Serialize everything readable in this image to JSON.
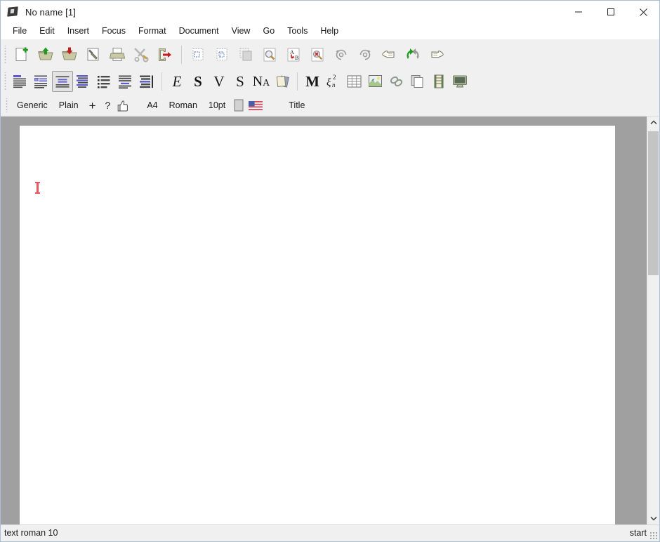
{
  "window": {
    "title": "No name [1]",
    "icon": "texmacs-logo-icon",
    "controls": [
      {
        "name": "minimize-button",
        "label": "–"
      },
      {
        "name": "maximize-button",
        "label": "□"
      },
      {
        "name": "close-button",
        "label": "✕"
      }
    ]
  },
  "menubar": {
    "items": [
      {
        "label": "File"
      },
      {
        "label": "Edit"
      },
      {
        "label": "Insert"
      },
      {
        "label": "Focus"
      },
      {
        "label": "Format"
      },
      {
        "label": "Document"
      },
      {
        "label": "View"
      },
      {
        "label": "Go"
      },
      {
        "label": "Tools"
      },
      {
        "label": "Help"
      }
    ]
  },
  "toolbar_main": {
    "items": [
      {
        "icon": "new-document-icon",
        "tip": "New document"
      },
      {
        "icon": "open-folder-icon",
        "tip": "Load file"
      },
      {
        "icon": "save-folder-icon",
        "tip": "Save file"
      },
      {
        "icon": "hammer-build-icon",
        "tip": "Build"
      },
      {
        "icon": "print-icon",
        "tip": "Print"
      },
      {
        "icon": "tools-scissors-wrench-icon",
        "tip": "Preferences"
      },
      {
        "icon": "exit-door-icon",
        "tip": "Close"
      },
      {
        "icon": "separator"
      },
      {
        "icon": "cut-icon",
        "tip": "Cut"
      },
      {
        "icon": "copy-icon",
        "tip": "Copy"
      },
      {
        "icon": "paste-icon",
        "tip": "Paste"
      },
      {
        "icon": "find-icon",
        "tip": "Search"
      },
      {
        "icon": "replace-icon",
        "tip": "Replace"
      },
      {
        "icon": "spell-check-icon",
        "tip": "Spell check"
      },
      {
        "icon": "undo-icon",
        "tip": "Undo"
      },
      {
        "icon": "redo-icon",
        "tip": "Redo"
      },
      {
        "icon": "hand-left-icon",
        "tip": "Back"
      },
      {
        "icon": "refresh-icon",
        "tip": "Refresh"
      },
      {
        "icon": "hand-right-icon",
        "tip": "Forward"
      }
    ]
  },
  "toolbar_format": {
    "items": [
      {
        "icon": "paragraph-style-icon",
        "active": false
      },
      {
        "icon": "theorem-style-icon",
        "active": false
      },
      {
        "icon": "center-block-icon",
        "active": true
      },
      {
        "icon": "align-center-icon",
        "active": false
      },
      {
        "icon": "bullet-list-icon",
        "active": false
      },
      {
        "icon": "numbered-block-icon",
        "active": false
      },
      {
        "icon": "indent-right-icon",
        "active": false
      },
      {
        "icon": "separator"
      },
      {
        "icon": "emphasize-icon",
        "glyph": "E"
      },
      {
        "icon": "strong-icon",
        "glyph": "S"
      },
      {
        "icon": "verbatim-icon",
        "glyph": "V"
      },
      {
        "icon": "sample-icon",
        "glyph": "S"
      },
      {
        "icon": "small-caps-icon",
        "glyph": "Na"
      },
      {
        "icon": "pages-stack-icon"
      },
      {
        "icon": "separator"
      },
      {
        "icon": "math-mode-icon",
        "glyph": "M"
      },
      {
        "icon": "formula-subscript-icon",
        "glyph": "ξ"
      },
      {
        "icon": "table-icon"
      },
      {
        "icon": "image-icon"
      },
      {
        "icon": "link-icon"
      },
      {
        "icon": "copies-icon"
      },
      {
        "icon": "film-strip-icon"
      },
      {
        "icon": "screen-icon"
      }
    ]
  },
  "toolbar_context": {
    "items": [
      {
        "kind": "label",
        "name": "style-generic",
        "label": "Generic"
      },
      {
        "kind": "label",
        "name": "style-plain",
        "label": "Plain"
      },
      {
        "kind": "icon",
        "name": "add-style-icon",
        "label": "+"
      },
      {
        "kind": "icon",
        "name": "help-style-icon",
        "label": "?"
      },
      {
        "kind": "icon",
        "name": "thumbs-up-icon",
        "label": ""
      },
      {
        "kind": "gap"
      },
      {
        "kind": "label",
        "name": "paper-size-a4",
        "label": "A4"
      },
      {
        "kind": "label",
        "name": "font-roman",
        "label": "Roman"
      },
      {
        "kind": "label",
        "name": "font-size-10pt",
        "label": "10pt"
      },
      {
        "kind": "icon",
        "name": "color-swatch-icon",
        "label": ""
      },
      {
        "kind": "icon",
        "name": "language-flag-us-icon",
        "label": ""
      },
      {
        "kind": "gap"
      },
      {
        "kind": "label",
        "name": "document-title",
        "label": "Title"
      }
    ]
  },
  "document": {
    "caret_visible": true,
    "page_content": ""
  },
  "scrollbar": {
    "up_arrow": "chevron-up-icon",
    "down_arrow": "chevron-down-icon"
  },
  "statusbar": {
    "left": "text roman 10",
    "right": "start"
  },
  "colors": {
    "caret": "#e8555f",
    "canvas": "#a0a0a0",
    "page": "#ffffff",
    "chrome": "#f0f0f0",
    "accent_blue": "#5c5ccc",
    "icon_green": "#1f9a1f",
    "icon_red": "#c41f1f"
  }
}
